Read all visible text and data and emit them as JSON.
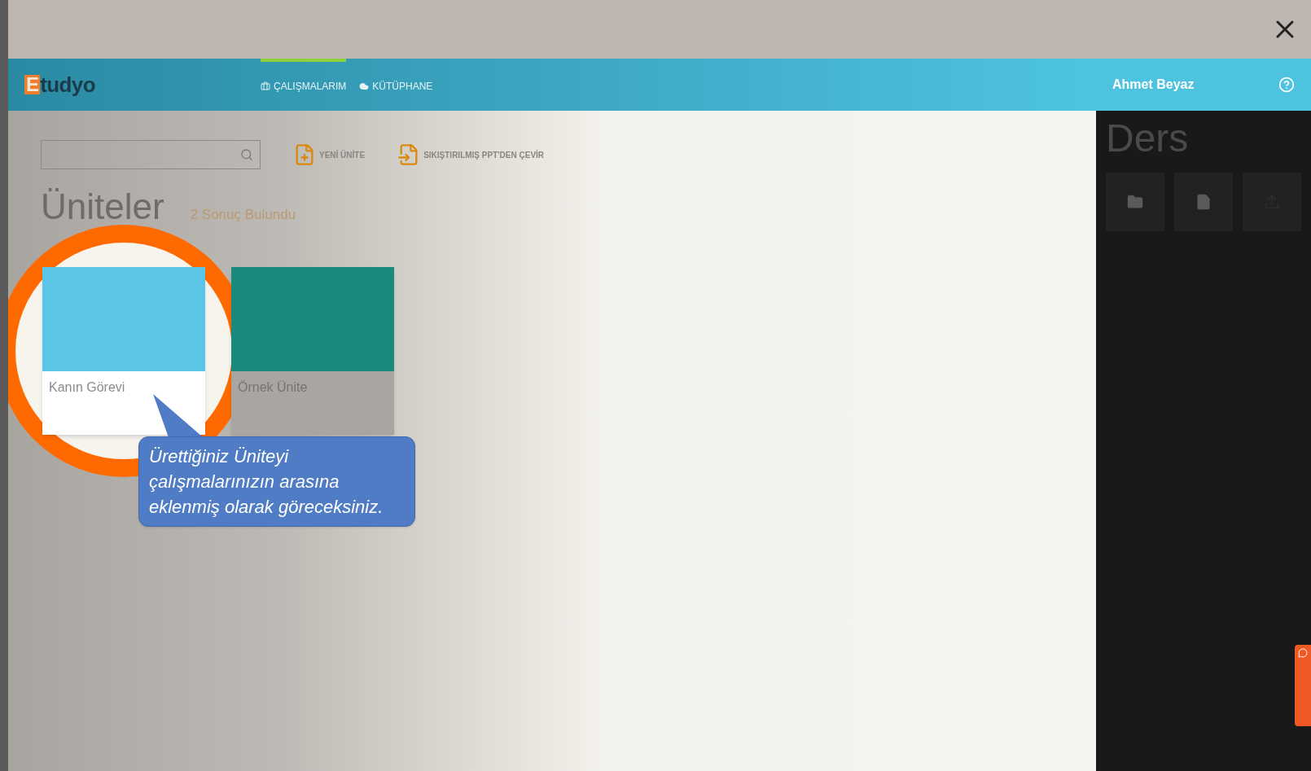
{
  "logo": {
    "badge": "E",
    "text": "tudyo"
  },
  "nav": [
    {
      "label": "ÇALIŞMALARIM",
      "kind": "briefcase",
      "selected": true
    },
    {
      "label": "KÜTÜPHANE",
      "kind": "cloud",
      "selected": false
    }
  ],
  "user": {
    "name": "Ahmet Beyaz"
  },
  "actions": [
    {
      "label": "YENİ ÜNİTE",
      "kind": "new"
    },
    {
      "label": "SIKIŞTIRILMIŞ PPT'DEN ÇEVİR",
      "kind": "convert"
    }
  ],
  "heading": "Üniteler",
  "result_count": "2 Sonuç Bulundu",
  "units": [
    {
      "title": "Kanın Görevi",
      "color": "#5bc5e6",
      "highlighted": true
    },
    {
      "title": "Örnek Ünite",
      "color": "#1a8a7e",
      "highlighted": false
    }
  ],
  "callout": {
    "lines": [
      "Ürettiğiniz Üniteyi",
      "çalışmalarınızın arasına",
      "eklenmiş olarak göreceksiniz."
    ]
  },
  "panel": {
    "title": "Ders",
    "tiles": [
      {
        "kind": "folder"
      },
      {
        "kind": "file"
      },
      {
        "kind": "upload"
      }
    ]
  }
}
